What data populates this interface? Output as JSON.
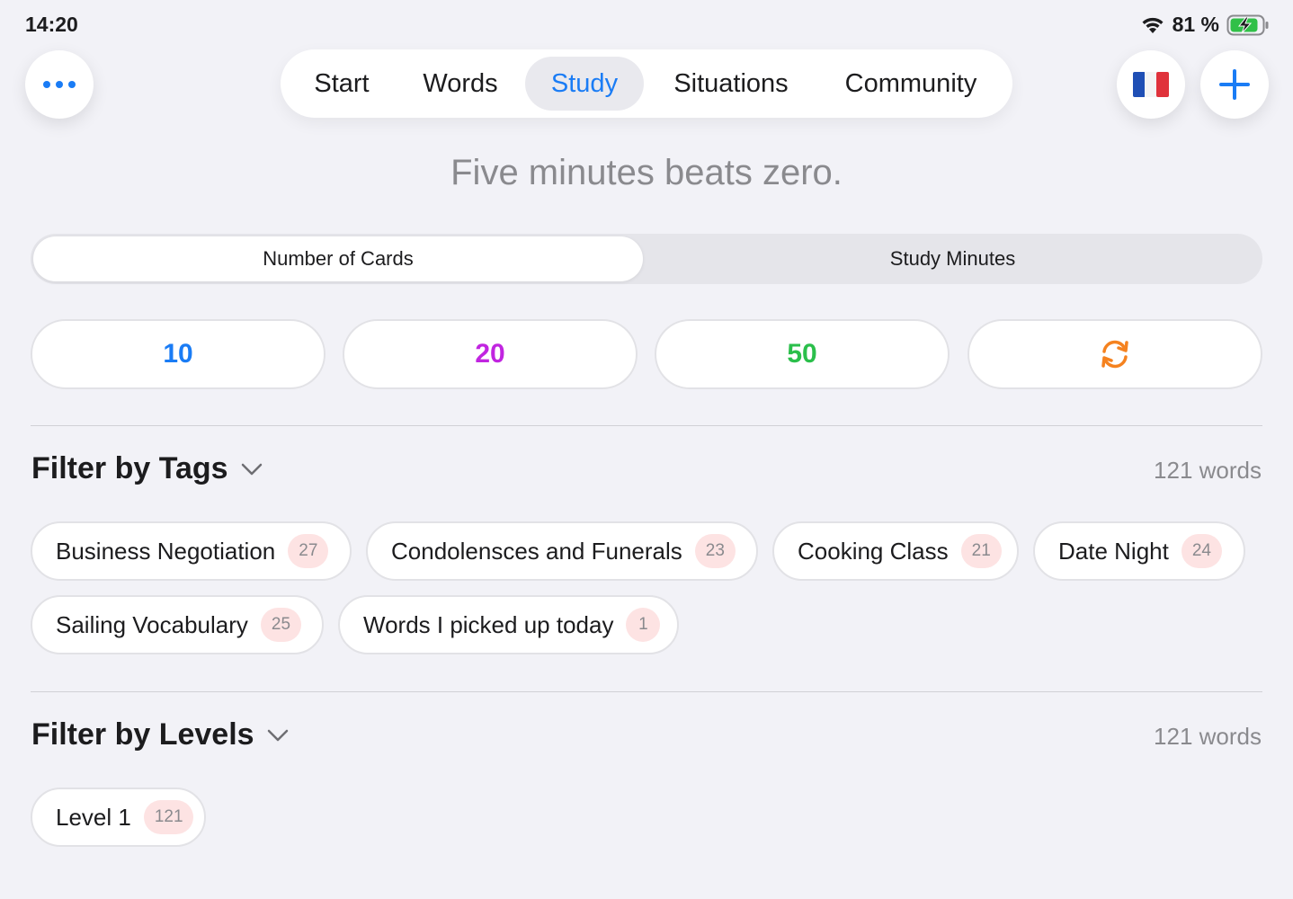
{
  "status_bar": {
    "time": "14:20",
    "battery_text": "81 %",
    "icons": [
      "wifi-icon",
      "battery-charging-icon"
    ]
  },
  "top_bar": {
    "more_icon": "ellipsis-icon",
    "flag_icon": "french-flag-icon",
    "add_icon": "plus-icon",
    "tabs": [
      {
        "label": "Start"
      },
      {
        "label": "Words"
      },
      {
        "label": "Study"
      },
      {
        "label": "Situations"
      },
      {
        "label": "Community"
      }
    ],
    "active_tab": "Study"
  },
  "motto": "Five minutes beats zero.",
  "mode_segment": {
    "options": [
      "Number of Cards",
      "Study Minutes"
    ],
    "selected": "Number of Cards"
  },
  "count_options": [
    {
      "label": "10",
      "color": "#1a7cf5"
    },
    {
      "label": "20",
      "color": "#c125e0"
    },
    {
      "label": "50",
      "color": "#2bbf4b"
    },
    {
      "icon": "refresh-icon",
      "color": "#f5821f"
    }
  ],
  "tags_section": {
    "title": "Filter by Tags",
    "count_text": "121 words",
    "chips": [
      {
        "label": "Business Negotiation",
        "count": "27"
      },
      {
        "label": "Condolensces and Funerals",
        "count": "23"
      },
      {
        "label": "Cooking Class",
        "count": "21"
      },
      {
        "label": "Date Night",
        "count": "24"
      },
      {
        "label": "Sailing Vocabulary",
        "count": "25"
      },
      {
        "label": "Words I picked up today",
        "count": "1"
      }
    ]
  },
  "levels_section": {
    "title": "Filter by Levels",
    "count_text": "121 words",
    "chips": [
      {
        "label": "Level 1",
        "count": "121"
      }
    ]
  },
  "colors": {
    "accent": "#1a7cf5",
    "background": "#f2f2f7",
    "badge_bg": "#fde3e3"
  }
}
